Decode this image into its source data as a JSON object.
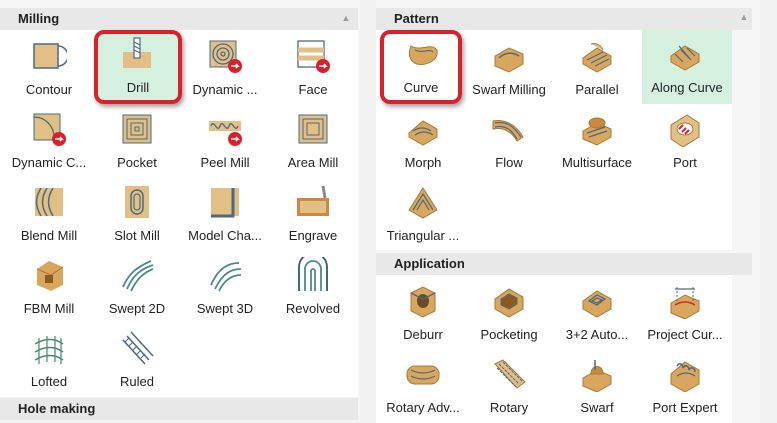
{
  "milling": {
    "title": "Milling",
    "tiles": [
      {
        "label": "Contour",
        "icon": "contour-icon"
      },
      {
        "label": "Drill",
        "icon": "drill-icon"
      },
      {
        "label": "Dynamic ...",
        "icon": "dynamic-icon"
      },
      {
        "label": "Face",
        "icon": "face-icon"
      },
      {
        "label": "Dynamic C...",
        "icon": "dynamic-contour-icon"
      },
      {
        "label": "Pocket",
        "icon": "pocket-icon"
      },
      {
        "label": "Peel Mill",
        "icon": "peel-mill-icon"
      },
      {
        "label": "Area Mill",
        "icon": "area-mill-icon"
      },
      {
        "label": "Blend Mill",
        "icon": "blend-mill-icon"
      },
      {
        "label": "Slot Mill",
        "icon": "slot-mill-icon"
      },
      {
        "label": "Model Cha...",
        "icon": "model-chamfer-icon"
      },
      {
        "label": "Engrave",
        "icon": "engrave-icon"
      },
      {
        "label": "FBM Mill",
        "icon": "fbm-mill-icon"
      },
      {
        "label": "Swept 2D",
        "icon": "swept-2d-icon"
      },
      {
        "label": "Swept 3D",
        "icon": "swept-3d-icon"
      },
      {
        "label": "Revolved",
        "icon": "revolved-icon"
      },
      {
        "label": "Lofted",
        "icon": "lofted-icon"
      },
      {
        "label": "Ruled",
        "icon": "ruled-icon"
      }
    ]
  },
  "hole_making": {
    "title": "Hole making"
  },
  "pattern": {
    "title": "Pattern",
    "tiles": [
      {
        "label": "Curve",
        "icon": "curve-icon"
      },
      {
        "label": "Swarf Milling",
        "icon": "swarf-milling-icon"
      },
      {
        "label": "Parallel",
        "icon": "parallel-icon"
      },
      {
        "label": "Along Curve",
        "icon": "along-curve-icon"
      },
      {
        "label": "Morph",
        "icon": "morph-icon"
      },
      {
        "label": "Flow",
        "icon": "flow-icon"
      },
      {
        "label": "Multisurface",
        "icon": "multisurface-icon"
      },
      {
        "label": "Port",
        "icon": "port-icon"
      },
      {
        "label": "Triangular ...",
        "icon": "triangular-icon"
      }
    ]
  },
  "application": {
    "title": "Application",
    "tiles": [
      {
        "label": "Deburr",
        "icon": "deburr-icon"
      },
      {
        "label": "Pocketing",
        "icon": "pocketing-icon"
      },
      {
        "label": "3+2 Auto...",
        "icon": "3plus2-auto-icon"
      },
      {
        "label": "Project Cur...",
        "icon": "project-curve-icon"
      },
      {
        "label": "Rotary Adv...",
        "icon": "rotary-advanced-icon"
      },
      {
        "label": "Rotary",
        "icon": "rotary-icon"
      },
      {
        "label": "Swarf",
        "icon": "swarf-icon"
      },
      {
        "label": "Port Expert",
        "icon": "port-expert-icon"
      }
    ]
  },
  "colors": {
    "accent_red": "#d9212c",
    "selected_bg": "#d6f0e0",
    "tan": "#e2bf85",
    "steel": "#4a6a80"
  }
}
